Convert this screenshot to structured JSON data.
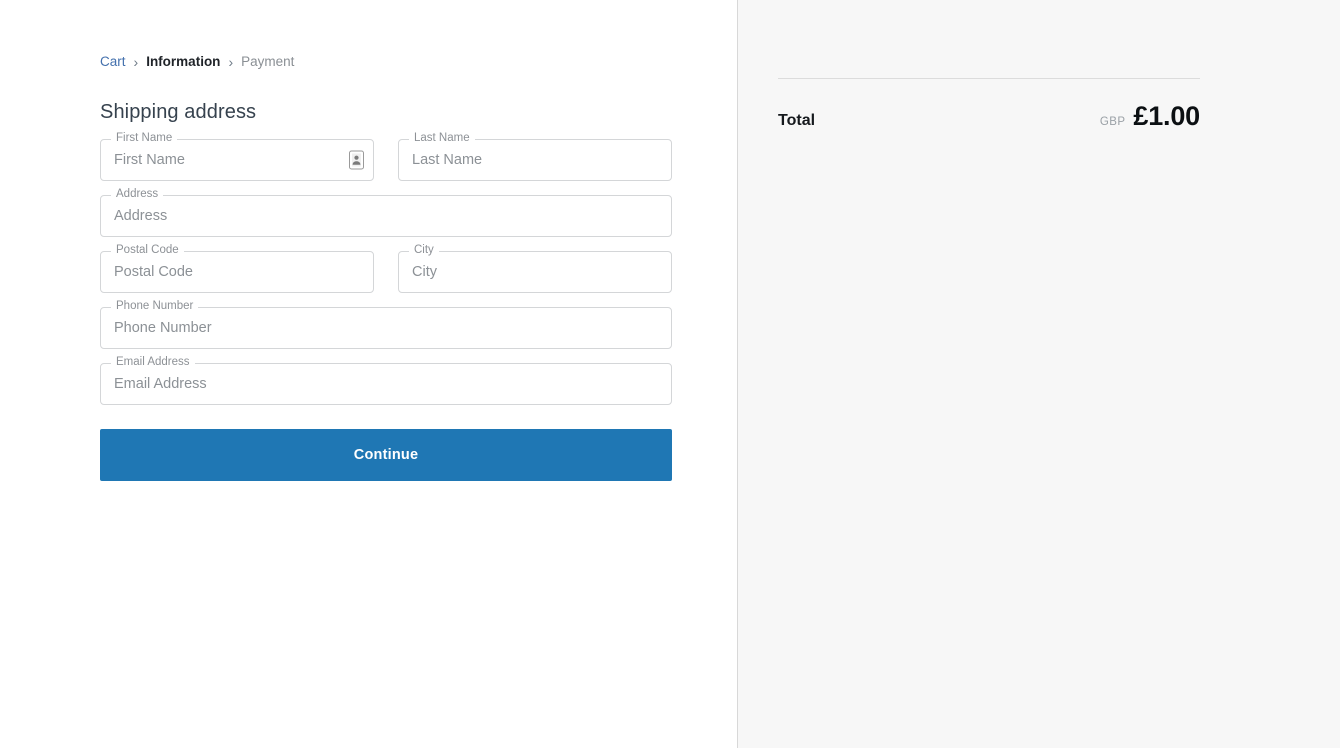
{
  "breadcrumb": {
    "separator": "›",
    "items": [
      {
        "label": "Cart",
        "state": "link"
      },
      {
        "label": "Information",
        "state": "current"
      },
      {
        "label": "Payment",
        "state": "upcoming"
      }
    ]
  },
  "form": {
    "title": "Shipping address",
    "fields": [
      {
        "label": "First Name",
        "placeholder": "First Name",
        "value": "",
        "icon": "autofill-contact-icon"
      },
      {
        "label": "Last Name",
        "placeholder": "Last Name",
        "value": ""
      },
      {
        "label": "Address",
        "placeholder": "Address",
        "value": ""
      },
      {
        "label": "Postal Code",
        "placeholder": "Postal Code",
        "value": ""
      },
      {
        "label": "City",
        "placeholder": "City",
        "value": ""
      },
      {
        "label": "Phone Number",
        "placeholder": "Phone Number",
        "value": ""
      },
      {
        "label": "Email Address",
        "placeholder": "Email Address",
        "value": ""
      }
    ],
    "submit_label": "Continue"
  },
  "summary": {
    "total_label": "Total",
    "currency_code": "GBP",
    "amount": "£1.00"
  },
  "colors": {
    "accent_blue": "#1f77b4",
    "link_blue": "#4370ad",
    "panel_background": "#f7f7f7",
    "field_border": "#d4d6d8",
    "muted_text": "#8c9196"
  }
}
